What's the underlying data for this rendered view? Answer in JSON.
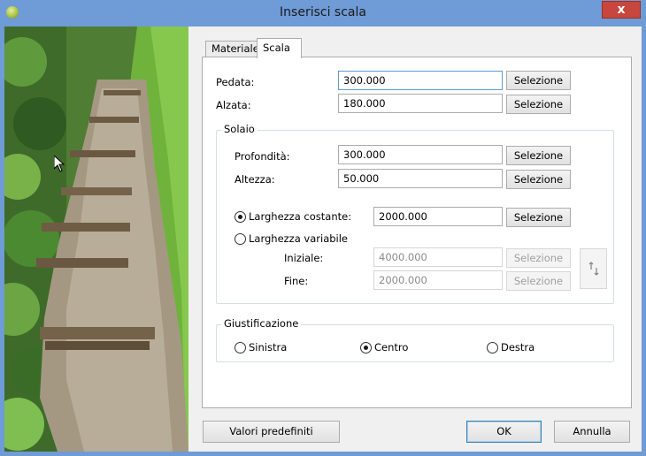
{
  "window": {
    "title": "Inserisci scala",
    "close_label": "x"
  },
  "tabs": [
    {
      "label": "Materiale",
      "active": false
    },
    {
      "label": "Scala",
      "active": true
    }
  ],
  "fields": {
    "pedata": {
      "label": "Pedata:",
      "value": "300.000",
      "button": "Selezione"
    },
    "alzata": {
      "label": "Alzata:",
      "value": "180.000",
      "button": "Selezione"
    }
  },
  "solaio": {
    "legend": "Solaio",
    "profondita": {
      "label": "Profondità:",
      "value": "300.000",
      "button": "Selezione"
    },
    "altezza": {
      "label": "Altezza:",
      "value": "50.000",
      "button": "Selezione"
    },
    "larghezza_costante": {
      "label": "Larghezza costante:",
      "value": "2000.000",
      "button": "Selezione",
      "checked": true
    },
    "larghezza_variabile": {
      "label": "Larghezza variabile",
      "checked": false
    },
    "iniziale": {
      "label": "Iniziale:",
      "value": "4000.000",
      "button": "Selezione"
    },
    "fine": {
      "label": "Fine:",
      "value": "2000.000",
      "button": "Selezione"
    },
    "swap_icon": "swap-arrows-icon"
  },
  "giustificazione": {
    "legend": "Giustificazione",
    "options": [
      {
        "label": "Sinistra",
        "checked": false
      },
      {
        "label": "Centro",
        "checked": true
      },
      {
        "label": "Destra",
        "checked": false
      }
    ]
  },
  "footer": {
    "defaults_label": "Valori predefiniti",
    "ok_label": "OK",
    "cancel_label": "Annulla"
  }
}
